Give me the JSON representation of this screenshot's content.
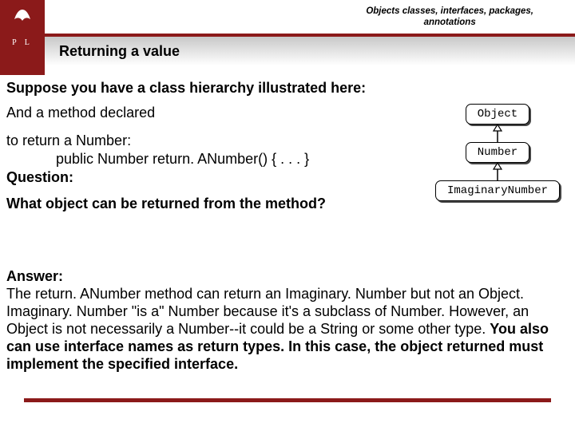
{
  "header": {
    "logo_text": "P  L",
    "top_right_line1": "Objects classes, interfaces, packages,",
    "top_right_line2": "annotations",
    "title": "Returning a value"
  },
  "content": {
    "intro": "Suppose you have a class hierarchy illustrated here:",
    "and_method": "And a method declared",
    "to_return": "to return a Number:",
    "code": "public Number return. ANumber() { . . . }",
    "question_label": "Question:",
    "question": "What object can be returned from the method?"
  },
  "hierarchy": {
    "n0": "Object",
    "n1": "Number",
    "n2": "ImaginaryNumber"
  },
  "answer": {
    "label": "Answer:",
    "p1": "The return. ANumber method can return an Imaginary. Number but not an Object. Imaginary. Number \"is a\" Number because it's a subclass of Number. However, an Object is not necessarily a Number--it could be a String or some other type.",
    "p2": "You also can use interface names as return types. In this case, the object returned must implement the specified interface."
  }
}
